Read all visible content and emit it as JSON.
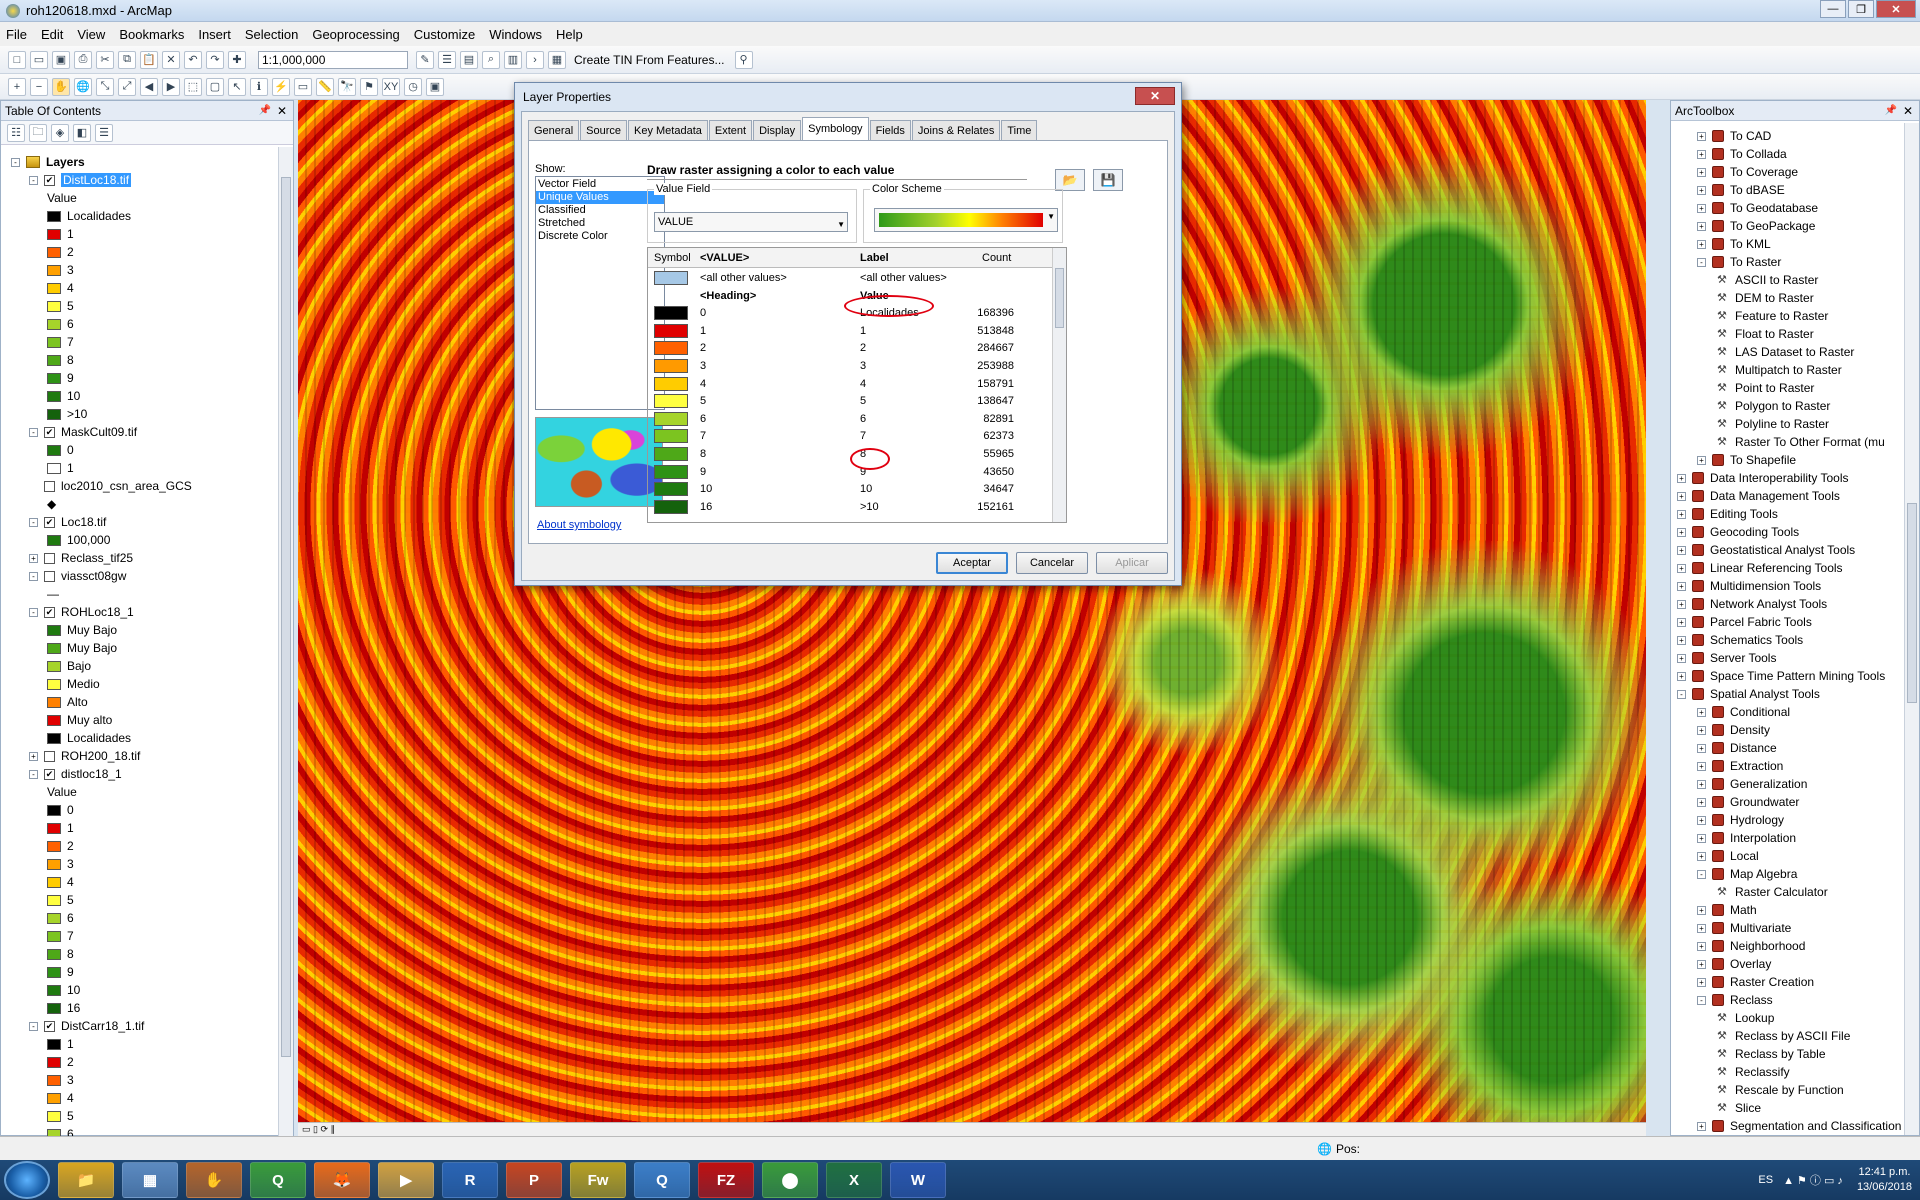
{
  "window": {
    "title": "roh120618.mxd - ArcMap"
  },
  "menu": [
    "File",
    "Edit",
    "View",
    "Bookmarks",
    "Insert",
    "Selection",
    "Geoprocessing",
    "Customize",
    "Windows",
    "Help"
  ],
  "toolbar": {
    "scale": "1:1,000,000",
    "tin_label": "Create TIN From Features..."
  },
  "toc": {
    "title": "Table Of Contents",
    "rows": [
      {
        "lvl": 0,
        "exp": "-",
        "chk": null,
        "text": "Layers",
        "bold": true
      },
      {
        "lvl": 1,
        "exp": "-",
        "chk": true,
        "text": "DistLoc18.tif",
        "sel": true
      },
      {
        "lvl": 2,
        "text": "Value"
      },
      {
        "lvl": 2,
        "sw": "#000000",
        "text": "Localidades"
      },
      {
        "lvl": 2,
        "sw": "#e00000",
        "text": "1"
      },
      {
        "lvl": 2,
        "sw": "#ff6000",
        "text": "2"
      },
      {
        "lvl": 2,
        "sw": "#ffa000",
        "text": "3"
      },
      {
        "lvl": 2,
        "sw": "#ffcc00",
        "text": "4"
      },
      {
        "lvl": 2,
        "sw": "#ffff40",
        "text": "5"
      },
      {
        "lvl": 2,
        "sw": "#a6d42a",
        "text": "6"
      },
      {
        "lvl": 2,
        "sw": "#7cc420",
        "text": "7"
      },
      {
        "lvl": 2,
        "sw": "#4ea818",
        "text": "8"
      },
      {
        "lvl": 2,
        "sw": "#2e9216",
        "text": "9"
      },
      {
        "lvl": 2,
        "sw": "#1f7a10",
        "text": "10"
      },
      {
        "lvl": 2,
        "sw": "#14620c",
        "text": ">10"
      },
      {
        "lvl": 1,
        "exp": "-",
        "chk": true,
        "text": "MaskCult09.tif"
      },
      {
        "lvl": 2,
        "sw": "#1f7a10",
        "text": "0"
      },
      {
        "lvl": 2,
        "sw": "#ffffff",
        "text": "1"
      },
      {
        "lvl": 1,
        "exp": "",
        "chk": false,
        "text": "loc2010_csn_area_GCS"
      },
      {
        "lvl": 2,
        "text": "◆"
      },
      {
        "lvl": 1,
        "exp": "-",
        "chk": true,
        "text": "Loc18.tif"
      },
      {
        "lvl": 2,
        "sw": "#1f7a10",
        "text": "100,000"
      },
      {
        "lvl": 1,
        "exp": "+",
        "chk": false,
        "text": "Reclass_tif25"
      },
      {
        "lvl": 1,
        "exp": "-",
        "chk": false,
        "text": "viassct08gw"
      },
      {
        "lvl": 2,
        "text": "—"
      },
      {
        "lvl": 1,
        "exp": "-",
        "chk": true,
        "text": "ROHLoc18_1"
      },
      {
        "lvl": 2,
        "sw": "#1f7a10",
        "text": "Muy Bajo"
      },
      {
        "lvl": 2,
        "sw": "#4ea818",
        "text": "Muy Bajo"
      },
      {
        "lvl": 2,
        "sw": "#a6d42a",
        "text": "Bajo"
      },
      {
        "lvl": 2,
        "sw": "#ffff40",
        "text": "Medio"
      },
      {
        "lvl": 2,
        "sw": "#ff8000",
        "text": "Alto"
      },
      {
        "lvl": 2,
        "sw": "#e00000",
        "text": "Muy alto"
      },
      {
        "lvl": 2,
        "sw": "#000000",
        "text": "Localidades"
      },
      {
        "lvl": 1,
        "exp": "+",
        "chk": false,
        "text": "ROH200_18.tif"
      },
      {
        "lvl": 1,
        "exp": "-",
        "chk": true,
        "text": "distloc18_1"
      },
      {
        "lvl": 2,
        "text": "Value"
      },
      {
        "lvl": 2,
        "sw": "#000000",
        "text": "0"
      },
      {
        "lvl": 2,
        "sw": "#e00000",
        "text": "1"
      },
      {
        "lvl": 2,
        "sw": "#ff6000",
        "text": "2"
      },
      {
        "lvl": 2,
        "sw": "#ffa000",
        "text": "3"
      },
      {
        "lvl": 2,
        "sw": "#ffcc00",
        "text": "4"
      },
      {
        "lvl": 2,
        "sw": "#ffff40",
        "text": "5"
      },
      {
        "lvl": 2,
        "sw": "#a6d42a",
        "text": "6"
      },
      {
        "lvl": 2,
        "sw": "#7cc420",
        "text": "7"
      },
      {
        "lvl": 2,
        "sw": "#4ea818",
        "text": "8"
      },
      {
        "lvl": 2,
        "sw": "#2e9216",
        "text": "9"
      },
      {
        "lvl": 2,
        "sw": "#1f7a10",
        "text": "10"
      },
      {
        "lvl": 2,
        "sw": "#14620c",
        "text": "16"
      },
      {
        "lvl": 1,
        "exp": "-",
        "chk": true,
        "text": "DistCarr18_1.tif"
      },
      {
        "lvl": 2,
        "sw": "#000000",
        "text": "1"
      },
      {
        "lvl": 2,
        "sw": "#e00000",
        "text": "2"
      },
      {
        "lvl": 2,
        "sw": "#ff6000",
        "text": "3"
      },
      {
        "lvl": 2,
        "sw": "#ffa000",
        "text": "4"
      },
      {
        "lvl": 2,
        "sw": "#ffff40",
        "text": "5"
      },
      {
        "lvl": 2,
        "sw": "#a6d42a",
        "text": "6"
      }
    ]
  },
  "atb": {
    "title": "ArcToolbox",
    "rows": [
      {
        "lvl": 1,
        "exp": "+",
        "t": "box",
        "text": "To CAD"
      },
      {
        "lvl": 1,
        "exp": "+",
        "t": "box",
        "text": "To Collada"
      },
      {
        "lvl": 1,
        "exp": "+",
        "t": "box",
        "text": "To Coverage"
      },
      {
        "lvl": 1,
        "exp": "+",
        "t": "box",
        "text": "To dBASE"
      },
      {
        "lvl": 1,
        "exp": "+",
        "t": "box",
        "text": "To Geodatabase"
      },
      {
        "lvl": 1,
        "exp": "+",
        "t": "box",
        "text": "To GeoPackage"
      },
      {
        "lvl": 1,
        "exp": "+",
        "t": "box",
        "text": "To KML"
      },
      {
        "lvl": 1,
        "exp": "-",
        "t": "box",
        "text": "To Raster"
      },
      {
        "lvl": 2,
        "t": "ham",
        "text": "ASCII to Raster"
      },
      {
        "lvl": 2,
        "t": "ham",
        "text": "DEM to Raster"
      },
      {
        "lvl": 2,
        "t": "ham",
        "text": "Feature to Raster"
      },
      {
        "lvl": 2,
        "t": "ham",
        "text": "Float to Raster"
      },
      {
        "lvl": 2,
        "t": "ham",
        "text": "LAS Dataset to Raster"
      },
      {
        "lvl": 2,
        "t": "ham",
        "text": "Multipatch to Raster"
      },
      {
        "lvl": 2,
        "t": "ham",
        "text": "Point to Raster"
      },
      {
        "lvl": 2,
        "t": "ham",
        "text": "Polygon to Raster"
      },
      {
        "lvl": 2,
        "t": "ham",
        "text": "Polyline to Raster"
      },
      {
        "lvl": 2,
        "t": "ham",
        "text": "Raster To Other Format (mu"
      },
      {
        "lvl": 1,
        "exp": "+",
        "t": "box",
        "text": "To Shapefile"
      },
      {
        "lvl": 0,
        "exp": "+",
        "t": "box",
        "text": "Data Interoperability Tools"
      },
      {
        "lvl": 0,
        "exp": "+",
        "t": "box",
        "text": "Data Management Tools"
      },
      {
        "lvl": 0,
        "exp": "+",
        "t": "box",
        "text": "Editing Tools"
      },
      {
        "lvl": 0,
        "exp": "+",
        "t": "box",
        "text": "Geocoding Tools"
      },
      {
        "lvl": 0,
        "exp": "+",
        "t": "box",
        "text": "Geostatistical Analyst Tools"
      },
      {
        "lvl": 0,
        "exp": "+",
        "t": "box",
        "text": "Linear Referencing Tools"
      },
      {
        "lvl": 0,
        "exp": "+",
        "t": "box",
        "text": "Multidimension Tools"
      },
      {
        "lvl": 0,
        "exp": "+",
        "t": "box",
        "text": "Network Analyst Tools"
      },
      {
        "lvl": 0,
        "exp": "+",
        "t": "box",
        "text": "Parcel Fabric Tools"
      },
      {
        "lvl": 0,
        "exp": "+",
        "t": "box",
        "text": "Schematics Tools"
      },
      {
        "lvl": 0,
        "exp": "+",
        "t": "box",
        "text": "Server Tools"
      },
      {
        "lvl": 0,
        "exp": "+",
        "t": "box",
        "text": "Space Time Pattern Mining Tools"
      },
      {
        "lvl": 0,
        "exp": "-",
        "t": "box",
        "text": "Spatial Analyst Tools"
      },
      {
        "lvl": 1,
        "exp": "+",
        "t": "box",
        "text": "Conditional"
      },
      {
        "lvl": 1,
        "exp": "+",
        "t": "box",
        "text": "Density"
      },
      {
        "lvl": 1,
        "exp": "+",
        "t": "box",
        "text": "Distance"
      },
      {
        "lvl": 1,
        "exp": "+",
        "t": "box",
        "text": "Extraction"
      },
      {
        "lvl": 1,
        "exp": "+",
        "t": "box",
        "text": "Generalization"
      },
      {
        "lvl": 1,
        "exp": "+",
        "t": "box",
        "text": "Groundwater"
      },
      {
        "lvl": 1,
        "exp": "+",
        "t": "box",
        "text": "Hydrology"
      },
      {
        "lvl": 1,
        "exp": "+",
        "t": "box",
        "text": "Interpolation"
      },
      {
        "lvl": 1,
        "exp": "+",
        "t": "box",
        "text": "Local"
      },
      {
        "lvl": 1,
        "exp": "-",
        "t": "box",
        "text": "Map Algebra"
      },
      {
        "lvl": 2,
        "t": "ham",
        "text": "Raster Calculator"
      },
      {
        "lvl": 1,
        "exp": "+",
        "t": "box",
        "text": "Math"
      },
      {
        "lvl": 1,
        "exp": "+",
        "t": "box",
        "text": "Multivariate"
      },
      {
        "lvl": 1,
        "exp": "+",
        "t": "box",
        "text": "Neighborhood"
      },
      {
        "lvl": 1,
        "exp": "+",
        "t": "box",
        "text": "Overlay"
      },
      {
        "lvl": 1,
        "exp": "+",
        "t": "box",
        "text": "Raster Creation"
      },
      {
        "lvl": 1,
        "exp": "-",
        "t": "box",
        "text": "Reclass"
      },
      {
        "lvl": 2,
        "t": "ham",
        "text": "Lookup"
      },
      {
        "lvl": 2,
        "t": "ham",
        "text": "Reclass by ASCII File"
      },
      {
        "lvl": 2,
        "t": "ham",
        "text": "Reclass by Table"
      },
      {
        "lvl": 2,
        "t": "ham",
        "text": "Reclassify"
      },
      {
        "lvl": 2,
        "t": "ham",
        "text": "Rescale by Function"
      },
      {
        "lvl": 2,
        "t": "ham",
        "text": "Slice"
      },
      {
        "lvl": 1,
        "exp": "+",
        "t": "box",
        "text": "Segmentation and Classification"
      }
    ]
  },
  "dialog": {
    "title": "Layer Properties",
    "close": "✕",
    "tabs": [
      "General",
      "Source",
      "Key Metadata",
      "Extent",
      "Display",
      "Symbology",
      "Fields",
      "Joins & Relates",
      "Time"
    ],
    "active_tab": "Symbology",
    "show_label": "Show:",
    "show_items": [
      "Vector Field",
      "Unique Values",
      "Classified",
      "Stretched",
      "Discrete Color"
    ],
    "show_selected": "Unique Values",
    "description": "Draw raster assigning a color to each value",
    "value_field_label": "Value Field",
    "value_field": "VALUE",
    "color_scheme_label": "Color Scheme",
    "about_link": "About symbology",
    "table": {
      "headers": {
        "symbol": "Symbol",
        "value": "<VALUE>",
        "label": "Label",
        "count": "Count"
      },
      "rows": [
        {
          "color": "#a6c8e6",
          "value": "<all other values>",
          "label": "<all other values>",
          "count": ""
        },
        {
          "color": "",
          "value": "<Heading>",
          "label": "Value",
          "count": "",
          "bold": true
        },
        {
          "color": "#000000",
          "value": "0",
          "label": "Localidades",
          "count": "168396"
        },
        {
          "color": "#e00000",
          "value": "1",
          "label": "1",
          "count": "513848"
        },
        {
          "color": "#ff6000",
          "value": "2",
          "label": "2",
          "count": "284667"
        },
        {
          "color": "#ff9a00",
          "value": "3",
          "label": "3",
          "count": "253988"
        },
        {
          "color": "#ffcc00",
          "value": "4",
          "label": "4",
          "count": "158791"
        },
        {
          "color": "#ffff40",
          "value": "5",
          "label": "5",
          "count": "138647"
        },
        {
          "color": "#a6d42a",
          "value": "6",
          "label": "6",
          "count": "82891"
        },
        {
          "color": "#7cc420",
          "value": "7",
          "label": "7",
          "count": "62373"
        },
        {
          "color": "#4ea818",
          "value": "8",
          "label": "8",
          "count": "55965"
        },
        {
          "color": "#2e9216",
          "value": "9",
          "label": "9",
          "count": "43650"
        },
        {
          "color": "#1f7a10",
          "value": "10",
          "label": "10",
          "count": "34647"
        },
        {
          "color": "#14620c",
          "value": "16",
          "label": ">10",
          "count": "152161"
        }
      ]
    },
    "buttons": {
      "ok": "Aceptar",
      "cancel": "Cancelar",
      "apply": "Aplicar"
    }
  },
  "statusbar": {
    "pos": "Pos:"
  },
  "taskbar": {
    "apps": [
      "📁",
      "▦",
      "✋",
      "Q",
      "🦊",
      "▶",
      "R",
      "P",
      "Fw",
      "Q",
      "FZ",
      "⬤",
      "X",
      "W"
    ],
    "lang": "ES",
    "time": "12:41 p.m.",
    "date": "13/06/2018"
  }
}
